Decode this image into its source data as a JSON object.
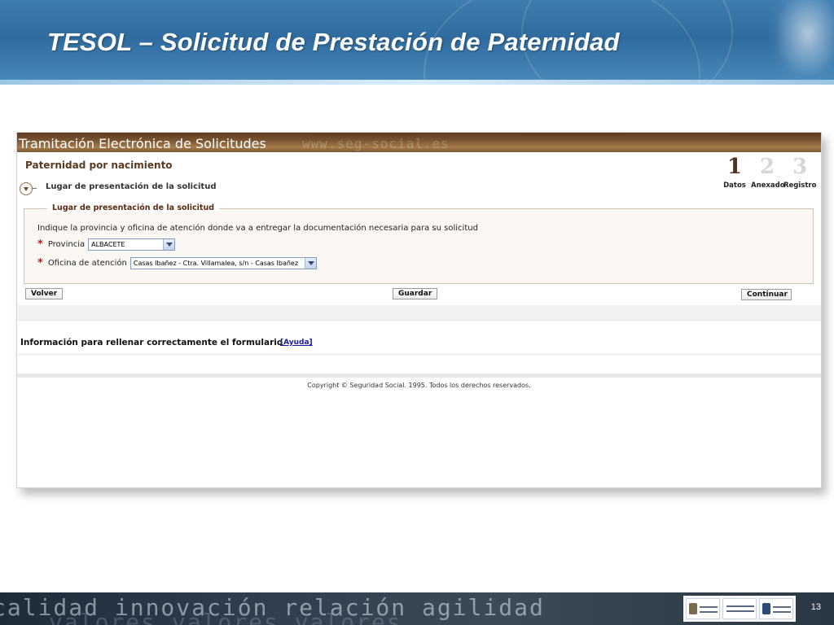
{
  "slide": {
    "title": "TESOL – Solicitud de Prestación de Paternidad",
    "page_number": "13",
    "footer_words": "calidad  innovación  relación  agilidad",
    "footer_words_back": "valores  valores  valores"
  },
  "app": {
    "banner_title": "Tramitación Electrónica de Solicitudes",
    "banner_watermark": "www.seg-social.es",
    "form_title": "Paternidad por nacimiento",
    "section_heading": "Lugar de presentación de la solicitud",
    "steps": [
      {
        "number": "1",
        "label": "Datos",
        "state": "active"
      },
      {
        "number": "2",
        "label": "Anexado",
        "state": "inactive"
      },
      {
        "number": "3",
        "label": "Registro",
        "state": "inactive"
      }
    ],
    "fieldset": {
      "legend": "Lugar de presentación de la solicitud",
      "instruction": "Indique la provincia y oficina de atención donde va a entregar la documentación necesaria para su solicitud",
      "required_mark": "*",
      "provincia_label": "Provincia",
      "provincia_value": "ALBACETE",
      "oficina_label": "Oficina de atención",
      "oficina_value": "Casas Ibañez - Ctra. Villamalea, s/n - Casas Ibañez"
    },
    "buttons": {
      "volver": "Volver",
      "guardar": "Guardar",
      "continuar": "Continuar"
    },
    "info_text": "Información para rellenar correctamente el formulario",
    "help_link": "[Ayuda]",
    "copyright": "Copyright © Seguridad Social. 1995. Todos los derechos reservados."
  },
  "colors": {
    "banner_brown": "#7b5531",
    "required_red": "#cc1111",
    "link_blue": "#1a1aa6",
    "header_blue": "#2f6b9e"
  }
}
